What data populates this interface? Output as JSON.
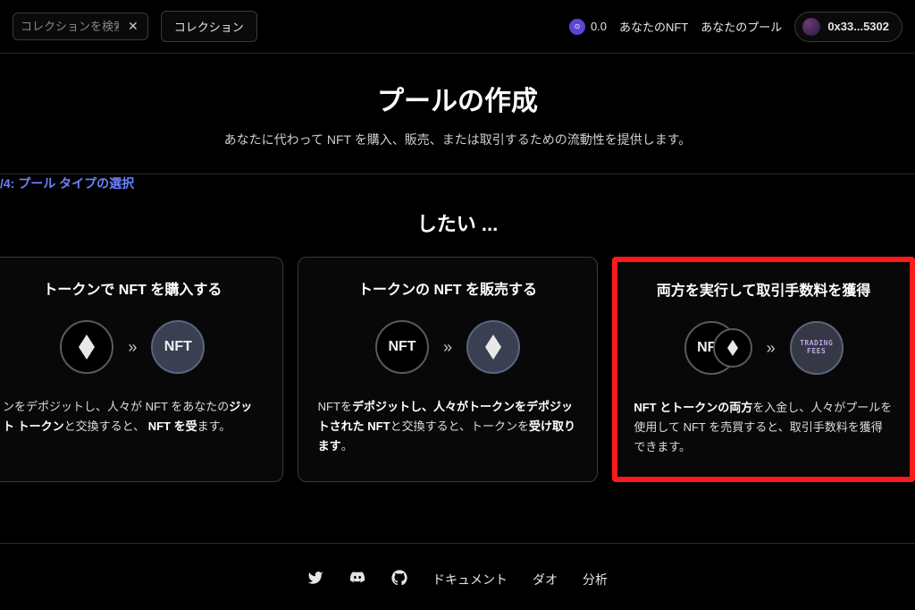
{
  "header": {
    "search_placeholder": "コレクションを検索",
    "collection_btn": "コレクション",
    "balance_value": "0.0",
    "nav_nft": "あなたのNFT",
    "nav_pool": "あなたのプール",
    "wallet_address": "0x33...5302"
  },
  "main": {
    "title": "プールの作成",
    "subtitle": "あなたに代わって NFT を購入、販売、または取引するための流動性を提供します。",
    "step_label": "/4: プール タイプの選択",
    "want_label": "したい ..."
  },
  "cards": [
    {
      "title": "トークンで NFT を購入する",
      "nft_label": "NFT",
      "desc_html": "ンをデポジットし、人々が NFT をあなたの<strong>ジット トークン</strong>と交換すると、 <strong>NFT を受</strong>ます。"
    },
    {
      "title": "トークンの NFT を販売する",
      "nft_label": "NFT",
      "desc_html": "NFTを<strong>デポジットし、人々がトークンをデポジットされた NFT</strong>と交換すると、トークンを<strong>受け取ります</strong>。"
    },
    {
      "title": "両方を実行して取引手数料を獲得",
      "nft_label": "NFT",
      "fees_l1": "TRADING",
      "fees_l2": "FEES",
      "desc_html": "<strong>NFT とトークンの両方</strong>を入金し、人々がプールを使用して NFT を売買すると、取引手数料を獲得できます。"
    }
  ],
  "footer": {
    "docs": "ドキュメント",
    "dao": "ダオ",
    "analytics": "分析"
  }
}
